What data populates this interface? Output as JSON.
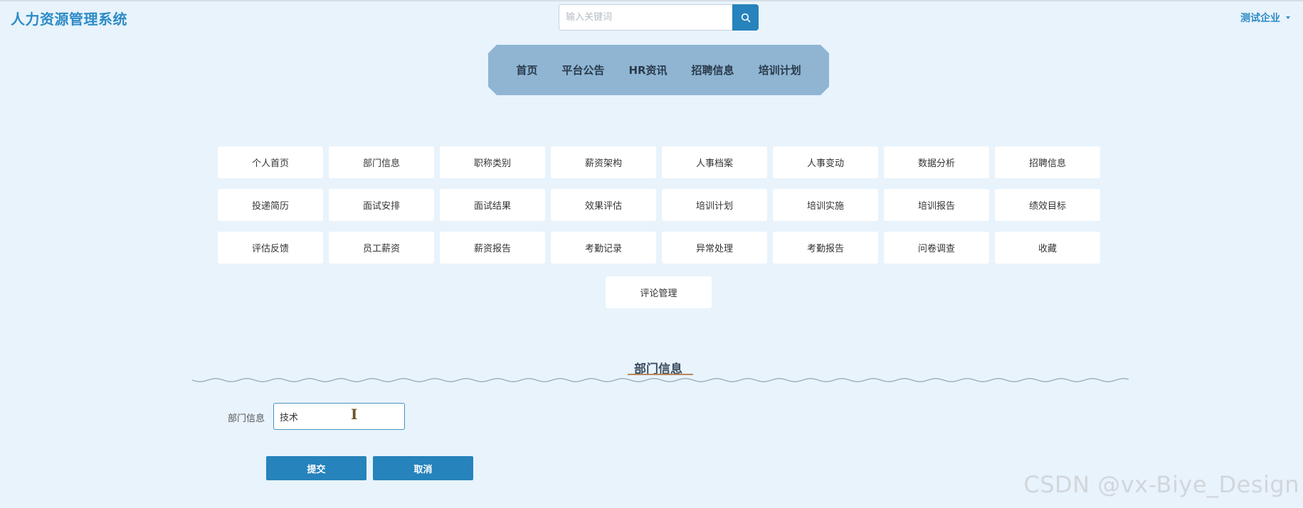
{
  "app": {
    "title": "人力资源管理系统"
  },
  "search": {
    "placeholder": "输入关键词",
    "icon": "search-icon"
  },
  "user": {
    "name": "测试企业"
  },
  "nav": [
    {
      "label": "首页"
    },
    {
      "label": "平台公告"
    },
    {
      "label": "HR资讯"
    },
    {
      "label": "招聘信息"
    },
    {
      "label": "培训计划"
    }
  ],
  "menu": [
    "个人首页",
    "部门信息",
    "职称类别",
    "薪资架构",
    "人事档案",
    "人事变动",
    "数据分析",
    "招聘信息",
    "投递简历",
    "面试安排",
    "面试结果",
    "效果评估",
    "培训计划",
    "培训实施",
    "培训报告",
    "绩效目标",
    "评估反馈",
    "员工薪资",
    "薪资报告",
    "考勤记录",
    "异常处理",
    "考勤报告",
    "问卷调查",
    "收藏"
  ],
  "menu_last": "评论管理",
  "section": {
    "title": "部门信息"
  },
  "form": {
    "label": "部门信息",
    "value": "技术"
  },
  "buttons": {
    "submit": "提交",
    "cancel": "取消"
  },
  "watermark": "CSDN @vx-Biye_Design",
  "colors": {
    "accent": "#2683bb",
    "nav_bg": "#8fb5d3",
    "page_bg": "#e8f3fc",
    "underline": "#b8875a"
  }
}
